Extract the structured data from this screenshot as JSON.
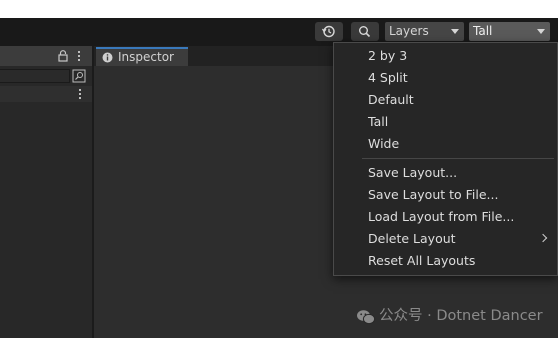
{
  "toolbar": {
    "layers_label": "Layers",
    "layout_label": "Tall"
  },
  "inspector": {
    "tab_label": "Inspector"
  },
  "layout_menu": {
    "presets": [
      "2 by 3",
      "4 Split",
      "Default",
      "Tall",
      "Wide"
    ],
    "actions": [
      {
        "label": "Save Layout...",
        "submenu": false
      },
      {
        "label": "Save Layout to File...",
        "submenu": false
      },
      {
        "label": "Load Layout from File...",
        "submenu": false
      },
      {
        "label": "Delete Layout",
        "submenu": true
      },
      {
        "label": "Reset All Layouts",
        "submenu": false
      }
    ]
  },
  "watermark": {
    "text": "公众号 · Dotnet Dancer"
  },
  "icons": {
    "history": "history-icon",
    "search": "search-icon",
    "lock": "lock-icon",
    "kebab": "kebab-menu-icon",
    "info": "info-icon",
    "wechat": "wechat-icon"
  },
  "colors": {
    "toolbar_bg": "#191919",
    "panel_bg": "#282828",
    "menu_bg": "#262626",
    "accent_tab": "#3a79bb"
  }
}
